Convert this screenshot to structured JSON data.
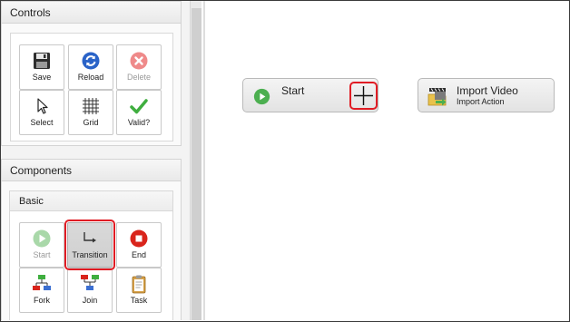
{
  "controls": {
    "title": "Controls",
    "buttons": {
      "save": "Save",
      "reload": "Reload",
      "delete": "Delete",
      "select": "Select",
      "grid": "Grid",
      "valid": "Valid?"
    }
  },
  "components": {
    "title": "Components",
    "basic": {
      "title": "Basic",
      "buttons": {
        "start": "Start",
        "transition": "Transition",
        "end": "End",
        "fork": "Fork",
        "join": "Join",
        "task": "Task"
      }
    }
  },
  "canvas": {
    "nodes": {
      "start": {
        "title": "Start"
      },
      "import_video": {
        "title": "Import Video",
        "subtitle": "Import Action"
      }
    }
  },
  "colors": {
    "highlight": "#e01c24",
    "start_green": "#4caf50",
    "end_red": "#d9251c",
    "reload_blue": "#2a63c8",
    "fork_red": "#d9251c",
    "fork_green": "#3fae3f",
    "fork_blue": "#3b6fd1"
  }
}
